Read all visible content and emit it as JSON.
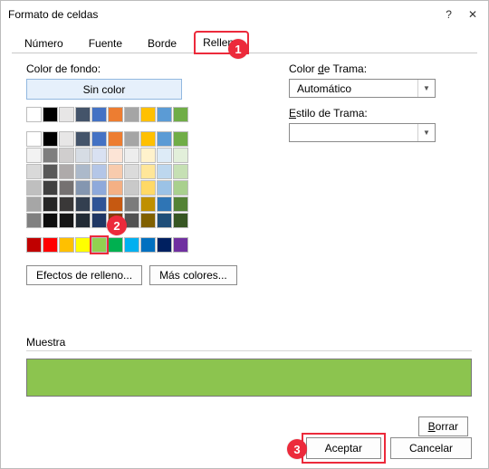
{
  "window": {
    "title": "Formato de celdas"
  },
  "tabs": {
    "items": [
      {
        "label": "Número"
      },
      {
        "label": "Fuente"
      },
      {
        "label": "Borde"
      },
      {
        "label": "Relleno"
      }
    ],
    "active_index": 3
  },
  "fill": {
    "bg_label": "Color de fondo:",
    "no_color_label": "Sin color",
    "effects_label": "Efectos de relleno...",
    "more_colors_label": "Más colores...",
    "trama_color_label_pre": "Color ",
    "trama_color_label_u": "d",
    "trama_color_label_post": "e Trama:",
    "trama_auto": "Automático",
    "trama_style_label_pre": "",
    "trama_style_label_u": "E",
    "trama_style_label_post": "stilo de Trama:",
    "palette_top_row": [
      "#ffffff",
      "#000000",
      "#e7e6e6",
      "#44546a",
      "#4472c4",
      "#ed7d31",
      "#a5a5a5",
      "#ffc000",
      "#5b9bd5",
      "#70ad47"
    ],
    "palette_shades": [
      [
        "#ffffff",
        "#f2f2f2",
        "#d9d9d9",
        "#bfbfbf",
        "#a6a6a6",
        "#808080"
      ],
      [
        "#000000",
        "#7f7f7f",
        "#595959",
        "#404040",
        "#262626",
        "#0d0d0d"
      ],
      [
        "#e7e6e6",
        "#d0cece",
        "#aeaaaa",
        "#757171",
        "#3a3838",
        "#161616"
      ],
      [
        "#44546a",
        "#d6dce4",
        "#acb9ca",
        "#8496b0",
        "#333f50",
        "#222b35"
      ],
      [
        "#4472c4",
        "#d9e1f2",
        "#b4c6e7",
        "#8ea9db",
        "#305496",
        "#203764"
      ],
      [
        "#ed7d31",
        "#fce4d6",
        "#f8cbad",
        "#f4b084",
        "#c65911",
        "#833c0c"
      ],
      [
        "#a5a5a5",
        "#ededed",
        "#dbdbdb",
        "#c9c9c9",
        "#7b7b7b",
        "#525252"
      ],
      [
        "#ffc000",
        "#fff2cc",
        "#ffe699",
        "#ffd966",
        "#bf8f00",
        "#806000"
      ],
      [
        "#5b9bd5",
        "#ddebf7",
        "#bdd7ee",
        "#9bc2e6",
        "#2f75b5",
        "#1f4e78"
      ],
      [
        "#70ad47",
        "#e2efda",
        "#c6e0b4",
        "#a9d08e",
        "#548235",
        "#375623"
      ]
    ],
    "standard_row": [
      "#c00000",
      "#ff0000",
      "#ffc000",
      "#ffff00",
      "#92d050",
      "#00b050",
      "#00b0f0",
      "#0070c0",
      "#002060",
      "#7030a0"
    ],
    "selected_standard_index": 4,
    "sample_color": "#8cc44f"
  },
  "muestra": {
    "label": "Muestra"
  },
  "buttons": {
    "borrar_u": "B",
    "borrar_rest": "orrar",
    "aceptar": "Aceptar",
    "cancelar": "Cancelar"
  },
  "callouts": {
    "one": "1",
    "two": "2",
    "three": "3"
  }
}
